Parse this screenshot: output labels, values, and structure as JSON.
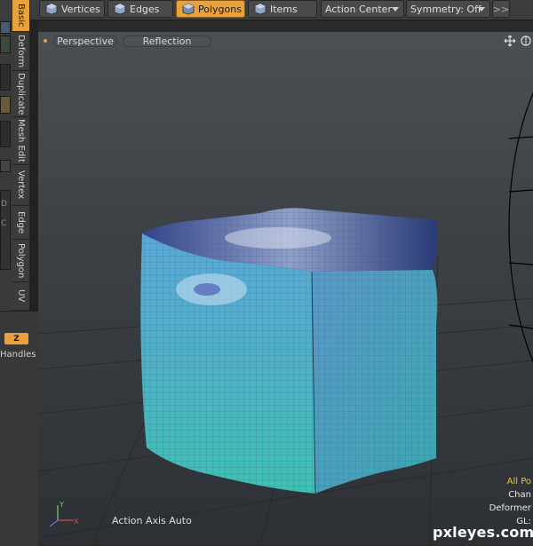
{
  "toolbar": {
    "modes": [
      {
        "label": "Vertices",
        "icon": "vertex-cube-icon",
        "active": false
      },
      {
        "label": "Edges",
        "icon": "edge-cube-icon",
        "active": false
      },
      {
        "label": "Polygons",
        "icon": "polygon-cube-icon",
        "active": true
      },
      {
        "label": "Items",
        "icon": "item-cube-icon",
        "active": false
      }
    ],
    "action_center": "Action Center",
    "symmetry": "Symmetry: Off",
    "more": ">>"
  },
  "side_tabs": [
    "Basic",
    "Deform",
    "Duplicate",
    "Mesh Edit",
    "Vertex",
    "Edge",
    "Polygon",
    "UV"
  ],
  "left_panel": {
    "axis_badge": "Z",
    "handles_label": "Handles",
    "partial_letters": [
      "D",
      "C"
    ]
  },
  "viewport": {
    "view_label": "Perspective",
    "shading_label": "Reflection",
    "action_axis_text": "Action Axis Auto",
    "info_lines": [
      "All Po",
      "Chan",
      "Deformer",
      "GL:"
    ]
  },
  "watermark": "pxleyes.com",
  "colors": {
    "accent": "#e9a23b",
    "toolbar_bg": "#3d3d3d",
    "viewport_bg": "#3c4145",
    "cube_side": "#4fb4c0",
    "cube_top": "#2a3a7a"
  }
}
